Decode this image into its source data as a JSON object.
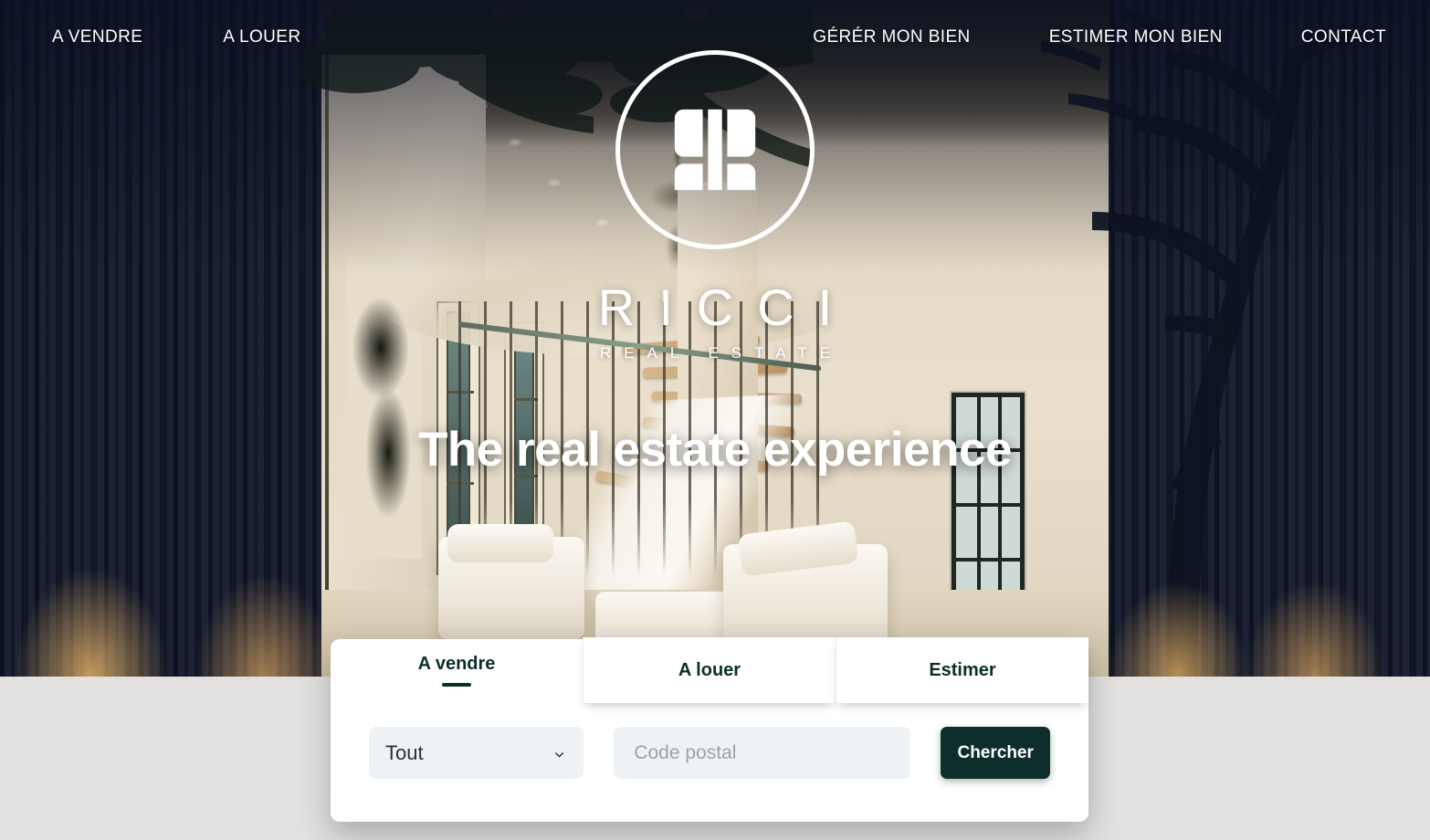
{
  "nav": {
    "left_items": [
      {
        "label": "A VENDRE",
        "name": "nav-a-vendre"
      },
      {
        "label": "A LOUER",
        "name": "nav-a-louer"
      }
    ],
    "right_items": [
      {
        "label": "GÉRÉR MON BIEN",
        "name": "nav-gerer-mon-bien"
      },
      {
        "label": "ESTIMER MON BIEN",
        "name": "nav-estimer-mon-bien"
      },
      {
        "label": "CONTACT",
        "name": "nav-contact"
      }
    ]
  },
  "brand": {
    "name": "RICCI",
    "subtitle": "REAL ESTATE",
    "logo_icon": "ricci-monogram-icon"
  },
  "hero": {
    "tagline": "The real estate experience"
  },
  "search": {
    "tabs": [
      {
        "label": "A vendre",
        "active": true
      },
      {
        "label": "A louer",
        "active": false
      },
      {
        "label": "Estimer",
        "active": false
      }
    ],
    "type_select": {
      "value": "Tout",
      "icon": "chevron-down-icon"
    },
    "zip": {
      "value": "",
      "placeholder": "Code postal"
    },
    "submit_label": "Chercher"
  },
  "colors": {
    "brand_dark": "#0d2e2b",
    "field_bg": "#eef2f5",
    "page_bg": "#e2e1df",
    "card_bg": "#ffffff"
  }
}
